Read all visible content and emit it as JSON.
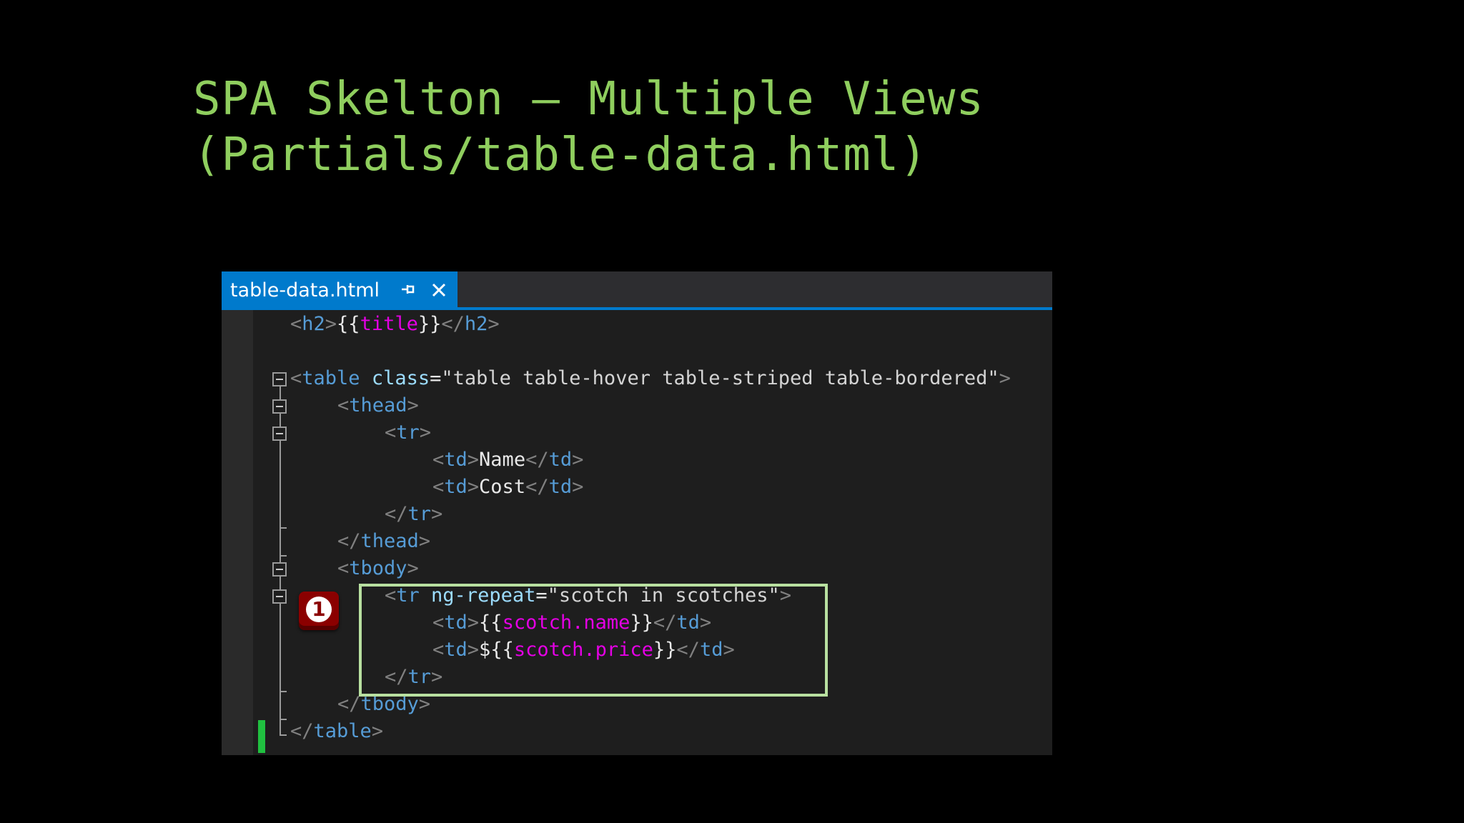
{
  "slide": {
    "title_line1": "SPA Skelton – Multiple Views",
    "title_line2": "(Partials/table-data.html)"
  },
  "editor": {
    "tab_label": "table-data.html",
    "pin_icon": "pin-icon",
    "close_icon": "close-icon",
    "colors": {
      "tab_active": "#007acc",
      "tag": "#569cd6",
      "binding": "#e400e4",
      "highlight_border": "#b8e0a0",
      "change_marker": "#20c040"
    }
  },
  "code": {
    "l1": {
      "o1": "<",
      "t1": "h2",
      "c1": ">",
      "b1": "{{",
      "v": "title",
      "b2": "}}",
      "o2": "</",
      "t2": "h2",
      "c2": ">"
    },
    "l3": {
      "o": "<",
      "t": "table",
      "sp": " ",
      "a": "class",
      "eq": "=",
      "s": "\"table table-hover table-striped table-bordered\"",
      "c": ">"
    },
    "l4": {
      "o": "<",
      "t": "thead",
      "c": ">"
    },
    "l5": {
      "o": "<",
      "t": "tr",
      "c": ">"
    },
    "l6": {
      "o1": "<",
      "t1": "td",
      "c1": ">",
      "x": "Name",
      "o2": "</",
      "t2": "td",
      "c2": ">"
    },
    "l7": {
      "o1": "<",
      "t1": "td",
      "c1": ">",
      "x": "Cost",
      "o2": "</",
      "t2": "td",
      "c2": ">"
    },
    "l8": {
      "o": "</",
      "t": "tr",
      "c": ">"
    },
    "l9": {
      "o": "</",
      "t": "thead",
      "c": ">"
    },
    "l10": {
      "o": "<",
      "t": "tbody",
      "c": ">"
    },
    "l11": {
      "o": "<",
      "t": "tr",
      "sp": " ",
      "a": "ng-repeat",
      "eq": "=",
      "s": "\"scotch in scotches\"",
      "c": ">"
    },
    "l12": {
      "o1": "<",
      "t1": "td",
      "c1": ">",
      "b1": "{{",
      "v": "scotch.name",
      "b2": "}}",
      "o2": "</",
      "t2": "td",
      "c2": ">"
    },
    "l13": {
      "o1": "<",
      "t1": "td",
      "c1": ">",
      "x": "$",
      "b1": "{{",
      "v": "scotch.price",
      "b2": "}}",
      "o2": "</",
      "t2": "td",
      "c2": ">"
    },
    "l14": {
      "o": "</",
      "t": "tr",
      "c": ">"
    },
    "l15": {
      "o": "</",
      "t": "tbody",
      "c": ">"
    },
    "l16": {
      "o": "</",
      "t": "table",
      "c": ">"
    }
  },
  "callout": {
    "number": "1"
  }
}
